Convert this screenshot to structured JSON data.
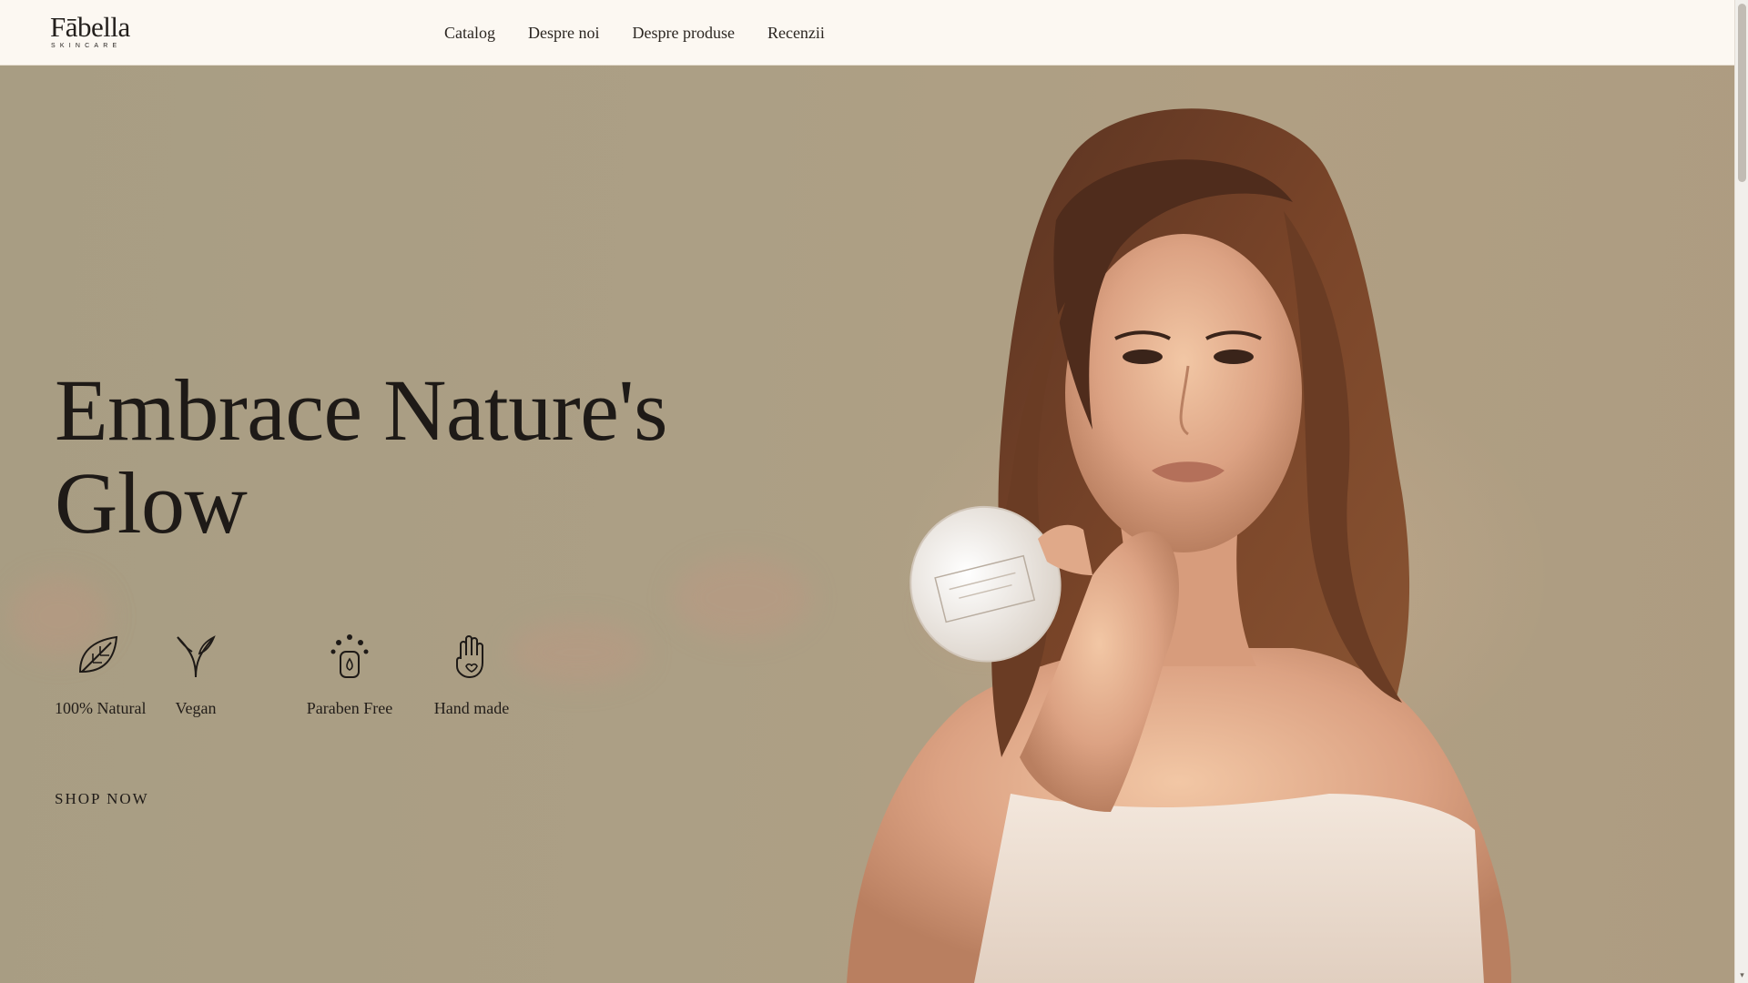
{
  "brand": {
    "name": "Fābella",
    "subtitle": "SKINCARE"
  },
  "nav": {
    "items": [
      {
        "label": "Catalog"
      },
      {
        "label": "Despre noi"
      },
      {
        "label": "Despre produse"
      },
      {
        "label": "Recenzii"
      }
    ]
  },
  "hero": {
    "title_line1": "Embrace Nature's",
    "title_line2": "Glow",
    "features": [
      {
        "label": "100% Natural",
        "icon": "leaf-icon"
      },
      {
        "label": "Vegan",
        "icon": "sprout-icon"
      },
      {
        "label": "Paraben Free",
        "icon": "droplet-bottle-icon"
      },
      {
        "label": "Hand made",
        "icon": "hand-icon"
      }
    ],
    "cta": "SHOP NOW"
  },
  "colors": {
    "header_bg": "#fcf8f2",
    "hero_bg": "#ab9e84",
    "text": "#1e1a17"
  }
}
